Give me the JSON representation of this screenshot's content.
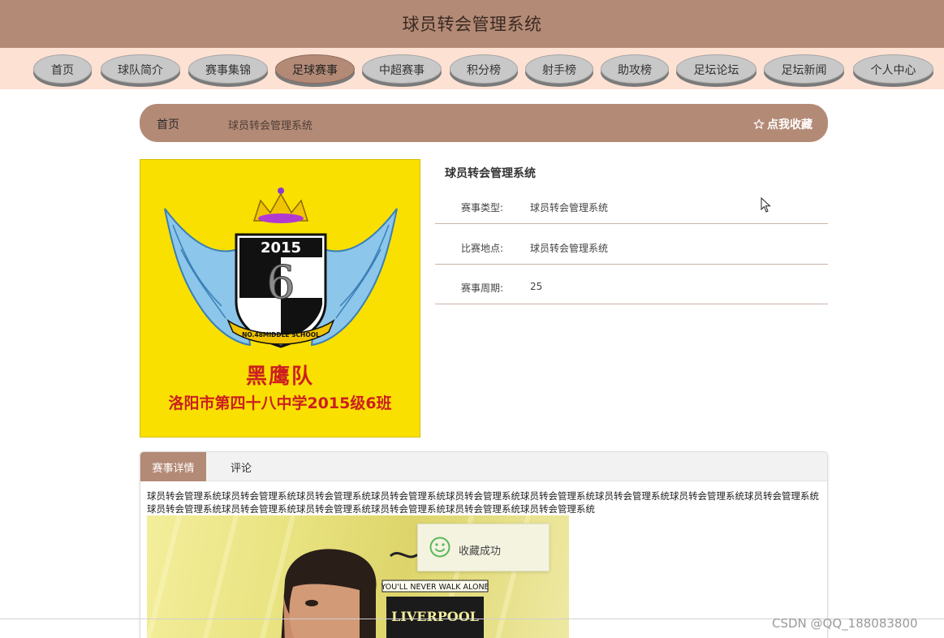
{
  "header": {
    "title": "球员转会管理系统"
  },
  "nav": {
    "items": [
      {
        "label": "首页"
      },
      {
        "label": "球队简介"
      },
      {
        "label": "赛事集锦"
      },
      {
        "label": "足球赛事"
      },
      {
        "label": "中超赛事"
      },
      {
        "label": "积分榜"
      },
      {
        "label": "射手榜"
      },
      {
        "label": "助攻榜"
      },
      {
        "label": "足坛论坛"
      },
      {
        "label": "足坛新闻"
      },
      {
        "label": "个人中心"
      }
    ],
    "active": "足球赛事"
  },
  "breadcrumb": {
    "home": "首页",
    "current": "球员转会管理系统",
    "favorite_label": "点我收藏"
  },
  "logo": {
    "badge_year": "2015",
    "badge_number": "6",
    "school_band": "NO.48MIDDLE SCHOOL",
    "team_name": "黑鹰队",
    "subtitle": "洛阳市第四十八中学2015级6班"
  },
  "info": {
    "title": "球员转会管理系统",
    "rows": [
      {
        "key": "赛事类型:",
        "value": "球员转会管理系统"
      },
      {
        "key": "比赛地点:",
        "value": "球员转会管理系统"
      },
      {
        "key": "赛事周期:",
        "value": "25"
      }
    ]
  },
  "tabs": {
    "detail": "赛事详情",
    "comment": "评论"
  },
  "detail": {
    "text": "球员转会管理系统球员转会管理系统球员转会管理系统球员转会管理系统球员转会管理系统球员转会管理系统球员转会管理系统球员转会管理系统球员转会管理系统球员转会管理系统球员转会管理系统球员转会管理系统球员转会管理系统球员转会管理系统球员转会管理系统",
    "poster_motto": "YOU'LL NEVER WALK ALONE",
    "poster_club": "LIVERPOOL"
  },
  "toast": {
    "message": "收藏成功"
  },
  "watermark": "CSDN @QQ_188083800",
  "colors": {
    "brand": "#b38a76",
    "nav_bg": "#fde1d3",
    "logo_bg": "#f9e000",
    "logo_text": "#cc1f1f"
  }
}
